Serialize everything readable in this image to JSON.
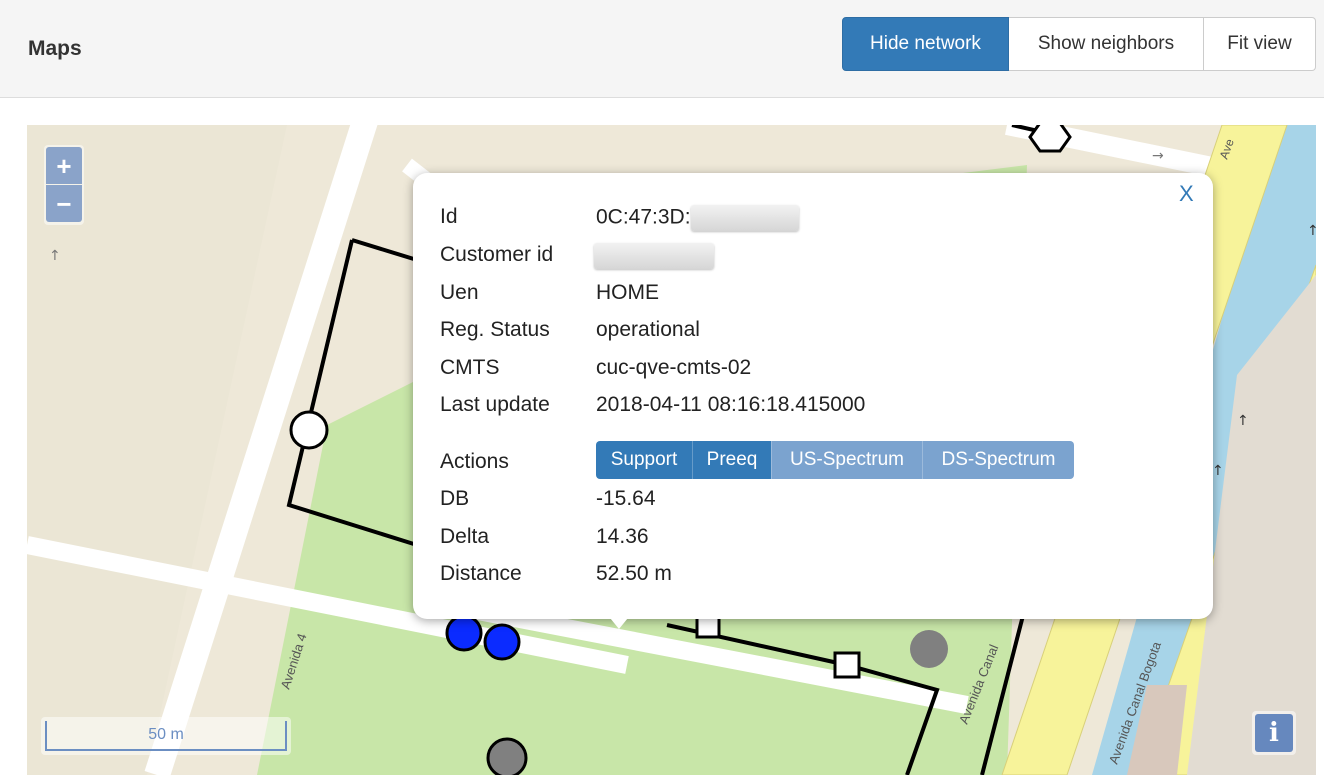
{
  "header": {
    "title": "Maps",
    "buttons": {
      "hide_network": "Hide network",
      "show_neighbors": "Show neighbors",
      "fit_view": "Fit view"
    }
  },
  "map": {
    "zoom_in": "+",
    "zoom_out": "−",
    "scale_label": "50 m",
    "info_label": "i",
    "street_labels": [
      "Avenida 4",
      "Avenida Canal",
      "Avenida Canal Bogota",
      "Ave"
    ]
  },
  "popup": {
    "close_label": "X",
    "fields": {
      "id_label": "Id",
      "id_value": "0C:47:3D:",
      "customer_id_label": "Customer id",
      "uen_label": "Uen",
      "uen_value": "HOME",
      "reg_status_label": "Reg. Status",
      "reg_status_value": "operational",
      "cmts_label": "CMTS",
      "cmts_value": "cuc-qve-cmts-02",
      "last_update_label": "Last update",
      "last_update_value": "2018-04-11 08:16:18.415000",
      "actions_label": "Actions",
      "db_label": "DB",
      "db_value": "-15.64",
      "delta_label": "Delta",
      "delta_value": "14.36",
      "distance_label": "Distance",
      "distance_value": "52.50 m"
    },
    "actions": {
      "support": "Support",
      "preeq": "Preeq",
      "us_spectrum": "US-Spectrum",
      "ds_spectrum": "DS-Spectrum"
    }
  },
  "colors": {
    "primary": "#337ab7",
    "park": "#c8e6a8",
    "road": "#ffffff",
    "major_road": "#f7f39a",
    "water": "#a7d4e8",
    "marker_blue": "#0b2bff",
    "marker_gray": "#808080"
  }
}
